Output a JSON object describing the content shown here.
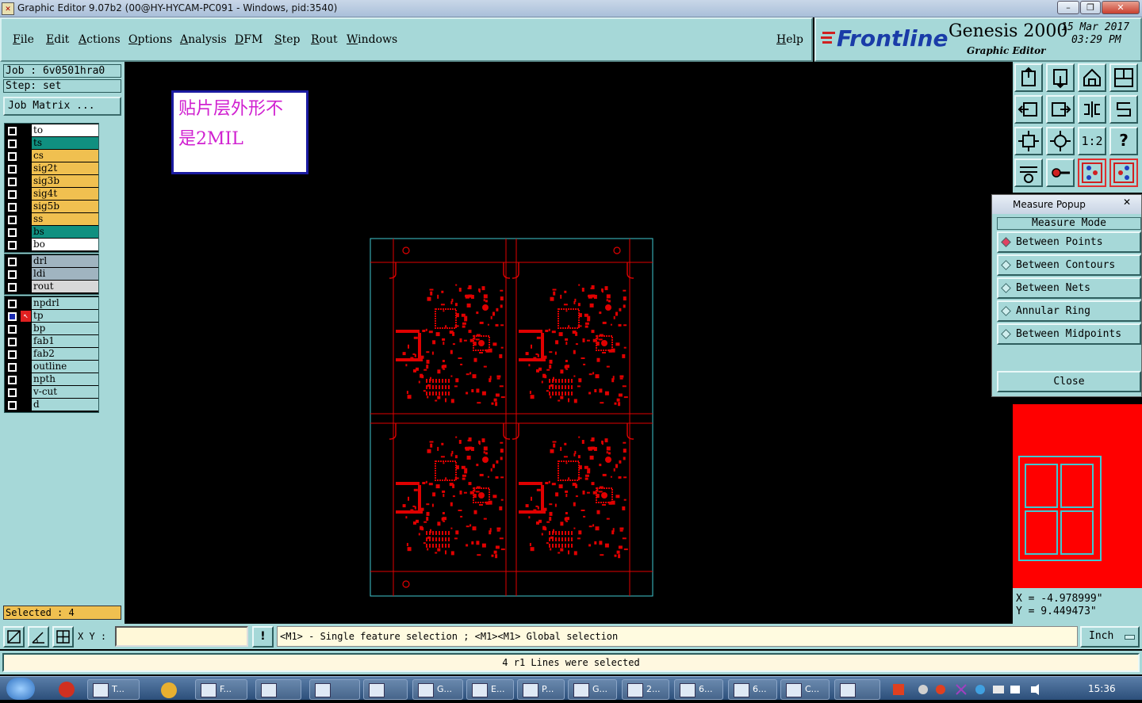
{
  "window": {
    "title": "Graphic Editor 9.07b2 (00@HY-HYCAM-PC091 - Windows, pid:3540)",
    "minimize": "–",
    "restore": "❐",
    "close": "✕"
  },
  "menu": {
    "items": [
      "File",
      "Edit",
      "Actions",
      "Options",
      "Analysis",
      "DFM",
      "Step",
      "Rout",
      "Windows"
    ],
    "help": "Help"
  },
  "brand": {
    "logo": "Frontline",
    "product": "Genesis 2000",
    "subtitle": "Graphic Editor",
    "date": "15 Mar 2017",
    "time": "03:29 PM"
  },
  "job": {
    "job_label": "Job : 6v0501hra0",
    "step_label": "Step: set",
    "matrix_button": "Job Matrix ..."
  },
  "layers": {
    "group1": [
      {
        "name": "to",
        "color": "#ffffff"
      },
      {
        "name": "ts",
        "color": "#109080"
      },
      {
        "name": "cs",
        "color": "#f0c050"
      },
      {
        "name": "sig2t",
        "color": "#f0c050"
      },
      {
        "name": "sig3b",
        "color": "#f0c050"
      },
      {
        "name": "sig4t",
        "color": "#f0c050"
      },
      {
        "name": "sig5b",
        "color": "#f0c050"
      },
      {
        "name": "ss",
        "color": "#f0c050"
      },
      {
        "name": "bs",
        "color": "#109080"
      },
      {
        "name": "bo",
        "color": "#ffffff"
      }
    ],
    "group2": [
      {
        "name": "drl",
        "color": "#a0b4c0"
      },
      {
        "name": "ldi",
        "color": "#a0b4c0"
      },
      {
        "name": "rout",
        "color": "#d8d8d8"
      }
    ],
    "group3": [
      {
        "name": "npdrl",
        "color": "#a6d8d8"
      },
      {
        "name": "tp",
        "color": "#a6d8d8"
      },
      {
        "name": "bp",
        "color": "#a6d8d8"
      },
      {
        "name": "fab1",
        "color": "#a6d8d8"
      },
      {
        "name": "fab2",
        "color": "#a6d8d8"
      },
      {
        "name": "outline",
        "color": "#a6d8d8"
      },
      {
        "name": "npth",
        "color": "#a6d8d8"
      },
      {
        "name": "v-cut",
        "color": "#a6d8d8"
      },
      {
        "name": "d",
        "color": "#a6d8d8"
      }
    ]
  },
  "selected": "Selected : 4",
  "note": {
    "line1": "贴片层外形不",
    "line2": "是2MIL"
  },
  "measure": {
    "title": "Measure Popup",
    "mode_header": "Measure Mode",
    "options": [
      "Between Points",
      "Between Contours",
      "Between Nets",
      "Annular Ring",
      "Between Midpoints"
    ],
    "close": "Close"
  },
  "tools": {
    "one_to_one": "1:2",
    "help": "?"
  },
  "coords": {
    "x": "X = -4.978999\"",
    "y": "Y = 9.449473\""
  },
  "command": {
    "xy_label": "X Y :",
    "xy_value": "",
    "warn": "!",
    "hint": "<M1> - Single feature selection ; <M1><M1> Global selection",
    "unit": "Inch"
  },
  "status": "4 r1 Lines were selected",
  "taskbar": {
    "items": [
      "T...",
      "F...",
      "",
      "",
      "G...",
      "E...",
      "P...",
      "G...",
      "2...",
      "6...",
      "6...",
      "C..."
    ],
    "clock": "15:36"
  },
  "colors": {
    "panel": "#a6d8d8",
    "board_outline": "#40c8d0",
    "feature": "#e00000"
  }
}
